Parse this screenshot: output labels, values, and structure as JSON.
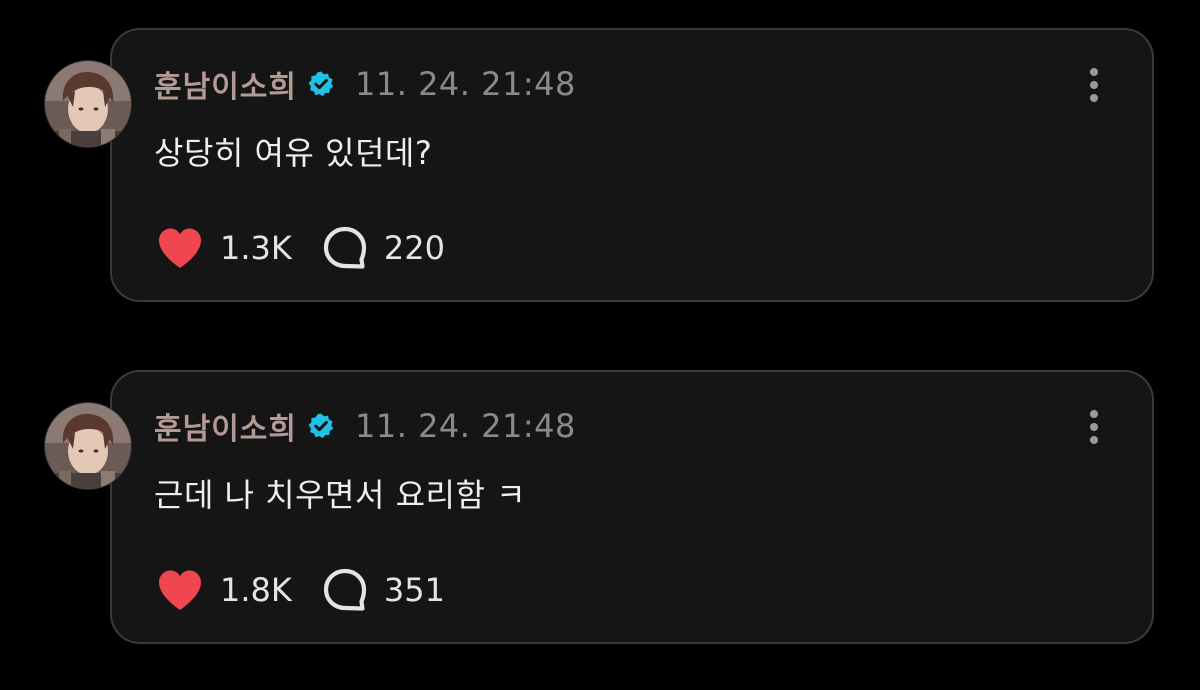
{
  "posts": [
    {
      "username": "훈남이소희",
      "timestamp": "11. 24. 21:48",
      "text": "상당히 여유 있던데?",
      "likes": "1.3K",
      "replies": "220"
    },
    {
      "username": "훈남이소희",
      "timestamp": "11. 24. 21:48",
      "text": "근데 나 치우면서 요리함 ㅋ",
      "likes": "1.8K",
      "replies": "351"
    }
  ],
  "colors": {
    "background": "#000000",
    "card": "#151515",
    "card_border": "#3a3a3a",
    "username": "#b39a95",
    "verified": "#1fc1e6",
    "like": "#f0464f",
    "text": "#eeeeee",
    "muted": "#8a8a8a"
  },
  "icons": {
    "verified": "verified-badge-icon",
    "like": "heart-icon",
    "reply": "speech-bubble-icon",
    "more": "vertical-ellipsis-icon"
  }
}
